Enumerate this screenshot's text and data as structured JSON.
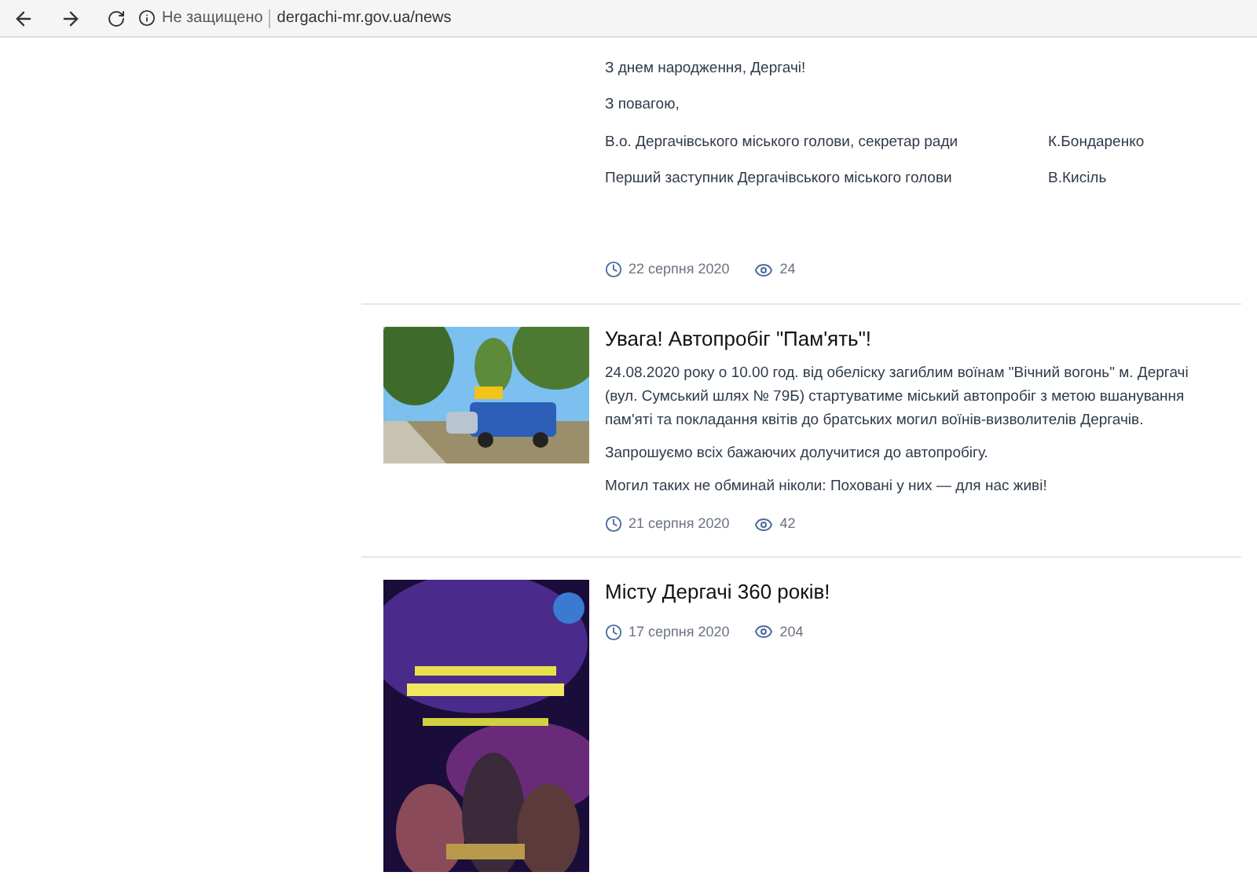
{
  "browser": {
    "security": "Не защищено",
    "url": "dergachi-mr.gov.ua/news"
  },
  "intro_article": {
    "paragraphs": [
      "З днем народження, Дергачі!",
      "З повагою,"
    ],
    "signatures": [
      {
        "position": "В.о. Дергачівського міського голови, секретар ради",
        "name": "К.Бондаренко"
      },
      {
        "position": "Перший заступник Дергачівського міського голови",
        "name": "В.Кисіль"
      }
    ],
    "date": "22 серпня 2020",
    "views": "24"
  },
  "news": [
    {
      "title": "Увага! Автопробіг \"Пам'ять\"!",
      "paragraphs": [
        "24.08.2020 року о 10.00 год. від обеліску загиблим воїнам \"Вічний вогонь\" м. Дергачі (вул. Сумський шлях № 79Б) стартуватиме міський автопробіг з метою вшанування пам'яті та покладання квітів до братських могил воїнів-визволителів Дергачів.",
        "Запрошуємо всіх бажаючих долучитися до автопробігу.",
        "Могил таких не обминай ніколи: Поховані у них — для нас живі!"
      ],
      "date": "21 серпня 2020",
      "views": "42"
    },
    {
      "title": "Місту Дергачі 360 років!",
      "date": "17 серпня 2020",
      "views": "204"
    }
  ]
}
